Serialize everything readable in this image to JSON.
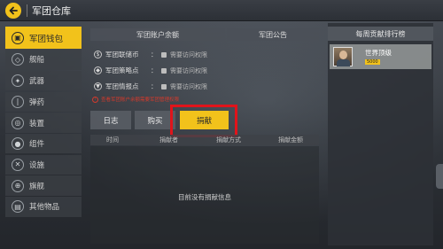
{
  "header": {
    "title": "军团仓库"
  },
  "nav": {
    "items": [
      {
        "label": "军团钱包",
        "icon": "wallet-icon",
        "glyph": "▣",
        "active": true
      },
      {
        "label": "舰船",
        "icon": "ship-icon",
        "glyph": "◇",
        "active": false
      },
      {
        "label": "武器",
        "icon": "weapon-icon",
        "glyph": "✦",
        "active": false
      },
      {
        "label": "弹药",
        "icon": "ammo-icon",
        "glyph": "❘",
        "active": false
      },
      {
        "label": "装置",
        "icon": "device-icon",
        "glyph": "◎",
        "active": false
      },
      {
        "label": "组件",
        "icon": "component-icon",
        "glyph": "●",
        "active": false
      },
      {
        "label": "设施",
        "icon": "facility-icon",
        "glyph": "✕",
        "active": false
      },
      {
        "label": "旗舰",
        "icon": "flagship-icon",
        "glyph": "⊕",
        "active": false
      },
      {
        "label": "其他物品",
        "icon": "misc-icon",
        "glyph": "▤",
        "active": false
      }
    ]
  },
  "balance": {
    "title": "军团账户余额",
    "rows": [
      {
        "label": "军团联储币",
        "colon": "：",
        "value": "需要访问权限",
        "icon": "coin-icon",
        "glyph": "$"
      },
      {
        "label": "军团策略点",
        "colon": "：",
        "value": "需要访问权限",
        "icon": "strategy-icon",
        "glyph": "◆"
      },
      {
        "label": "军团情报点",
        "colon": "：",
        "value": "需要访问权限",
        "icon": "intel-icon",
        "glyph": "▼"
      }
    ],
    "warning": "查看军团账户余额需要军团管理权限"
  },
  "notice": {
    "title": "军团公告"
  },
  "tabs": [
    {
      "label": "日志",
      "active": false
    },
    {
      "label": "购买",
      "active": false
    },
    {
      "label": "捐献",
      "active": true
    }
  ],
  "columns": [
    "时间",
    "捐献者",
    "捐献方式",
    "捐献金额"
  ],
  "empty_message": "目前没有捐献信息",
  "ranking": {
    "title": "每周贡献排行榜",
    "entry": {
      "name": "世界顶级",
      "badge": "5000"
    }
  },
  "colors": {
    "accent": "#f2c21b",
    "highlight": "#e0141b",
    "warning": "#d33a2c"
  }
}
